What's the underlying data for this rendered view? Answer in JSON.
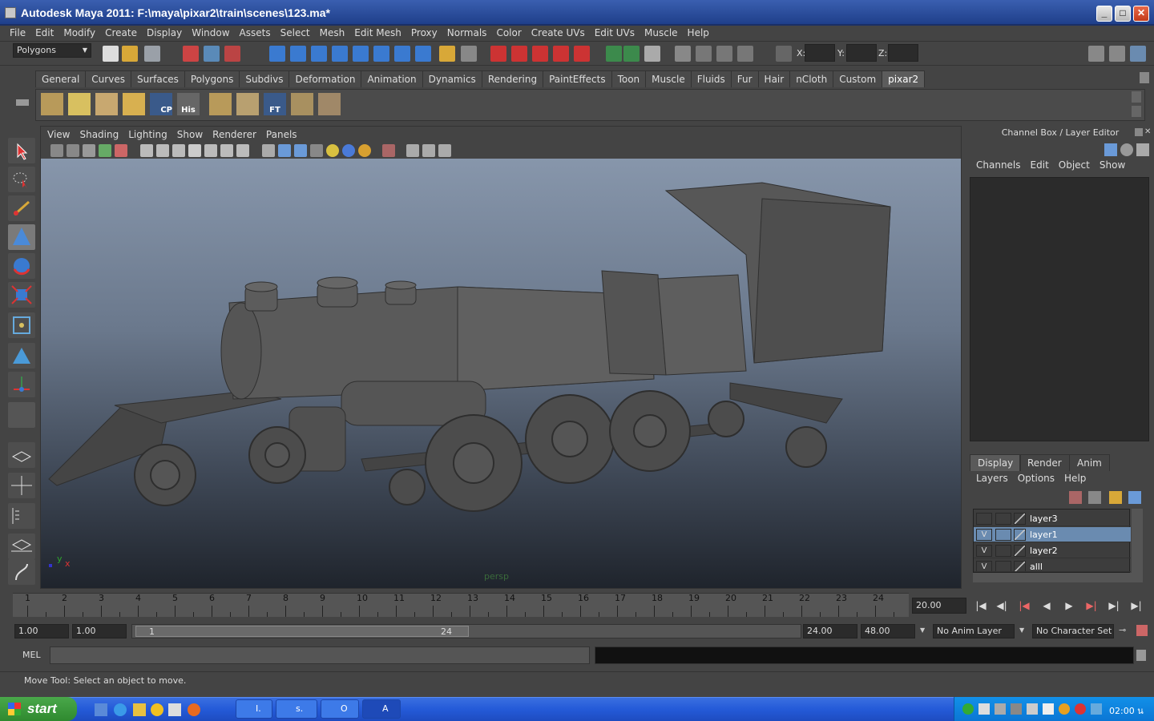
{
  "window": {
    "title": "Autodesk Maya 2011: F:\\maya\\pixar2\\train\\scenes\\123.ma*"
  },
  "menubar": [
    "File",
    "Edit",
    "Modify",
    "Create",
    "Display",
    "Window",
    "Assets",
    "Select",
    "Mesh",
    "Edit Mesh",
    "Proxy",
    "Normals",
    "Color",
    "Create UVs",
    "Edit UVs",
    "Muscle",
    "Help"
  ],
  "statusline": {
    "mode": "Polygons",
    "x_label": "X:",
    "y_label": "Y:",
    "z_label": "Z:"
  },
  "shelf": {
    "tabs": [
      "General",
      "Curves",
      "Surfaces",
      "Polygons",
      "Subdivs",
      "Deformation",
      "Animation",
      "Dynamics",
      "Rendering",
      "PaintEffects",
      "Toon",
      "Muscle",
      "Fluids",
      "Fur",
      "Hair",
      "nCloth",
      "Custom",
      "pixar2"
    ],
    "active": "pixar2",
    "icon_labels": {
      "cp": "CP",
      "his": "His",
      "ft": "FT"
    }
  },
  "viewport": {
    "menu": [
      "View",
      "Shading",
      "Lighting",
      "Show",
      "Renderer",
      "Panels"
    ],
    "camera": "persp",
    "axis_y": "y",
    "axis_x": "x"
  },
  "channel_box": {
    "title": "Channel Box / Layer Editor",
    "menu": [
      "Channels",
      "Edit",
      "Object",
      "Show"
    ]
  },
  "layer_editor": {
    "tabs": [
      "Display",
      "Render",
      "Anim"
    ],
    "active_tab": "Display",
    "menu": [
      "Layers",
      "Options",
      "Help"
    ],
    "layers": [
      {
        "name": "layer3",
        "visible": "",
        "selected": false
      },
      {
        "name": "layer1",
        "visible": "V",
        "selected": true
      },
      {
        "name": "layer2",
        "visible": "V",
        "selected": false
      },
      {
        "name": "alll",
        "visible": "V",
        "selected": false
      }
    ]
  },
  "timeline": {
    "frames": [
      "1",
      "2",
      "3",
      "4",
      "5",
      "6",
      "7",
      "8",
      "9",
      "10",
      "11",
      "12",
      "13",
      "14",
      "15",
      "16",
      "17",
      "18",
      "19",
      "20",
      "21",
      "22",
      "23",
      "24"
    ],
    "current_time": "20.00"
  },
  "range": {
    "start": "1.00",
    "start2": "1.00",
    "slider_start": "1",
    "slider_end": "24",
    "end": "24.00",
    "end2": "48.00",
    "anim_layer": "No Anim Layer",
    "character_set": "No Character Set"
  },
  "command": {
    "label": "MEL"
  },
  "help_line": "Move Tool: Select an object to move.",
  "taskbar": {
    "start": "start",
    "tasks": [
      "I.",
      "s.",
      "O",
      "A"
    ],
    "clock": "02:00 น"
  },
  "colors": {
    "accent": "#6a8bb0",
    "ui_bg": "#444444",
    "title": "#2a4fa0"
  }
}
